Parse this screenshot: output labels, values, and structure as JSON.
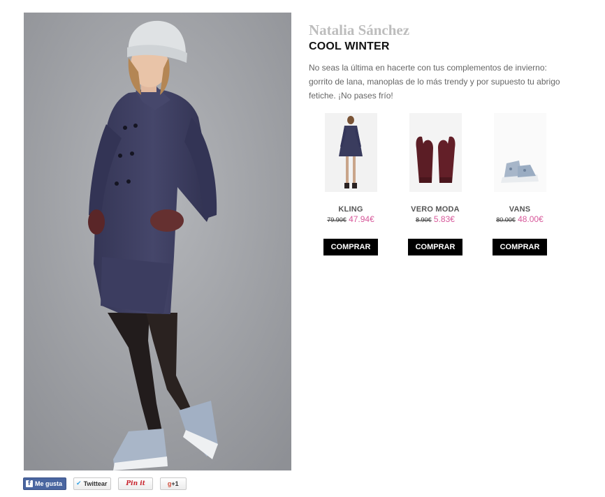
{
  "article": {
    "author": "Natalia Sánchez",
    "title": "COOL WINTER",
    "description": "No seas la última en hacerte con tus complementos de invierno: gorrito de lana, manoplas de lo más trendy y por supuesto tu abrigo fetiche. ¡No pases frío!"
  },
  "products": [
    {
      "brand": "KLING",
      "old_price": "79.90€",
      "new_price": "47.94€",
      "button": "COMPRAR"
    },
    {
      "brand": "VERO MODA",
      "old_price": "8.90€",
      "new_price": "5.83€",
      "button": "COMPRAR"
    },
    {
      "brand": "VANS",
      "old_price": "80.00€",
      "new_price": "48.00€",
      "button": "COMPRAR"
    }
  ],
  "social": {
    "facebook": "Me gusta",
    "twitter": "Twittear",
    "pinterest": "Pin it",
    "google": "+1"
  },
  "colors": {
    "coat": "#3f3f62",
    "sale_price": "#d7589a",
    "button_bg": "#000000",
    "author_text": "#bdbdbd"
  }
}
